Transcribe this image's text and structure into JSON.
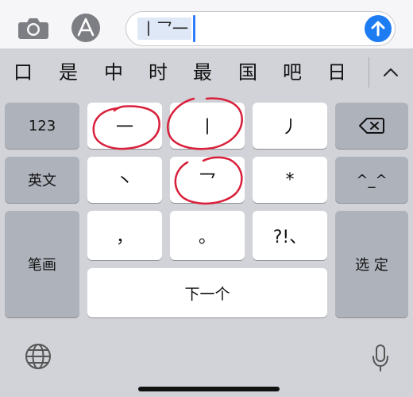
{
  "input": {
    "composition_text": "丨乛一",
    "send_button": "send"
  },
  "candidate_bar": {
    "items": [
      "口",
      "是",
      "中",
      "时",
      "最",
      "国",
      "吧",
      "日"
    ],
    "expand_icon": "chevron-up-icon"
  },
  "keyboard": {
    "key_123": "123",
    "key_english": "英文",
    "key_strokes_mode": "笔画",
    "key_heng": "一",
    "key_shu": "丨",
    "key_pie": "丿",
    "key_dian": "丶",
    "key_zhe": "乛",
    "key_wildcard": "*",
    "key_comma": "，",
    "key_period": "。",
    "key_punct": "?!、",
    "key_next": "下一个",
    "key_emoji": "^_^",
    "key_select": "选 定",
    "delete_icon": "backspace-icon"
  },
  "icons": {
    "camera": "camera-icon",
    "appstore": "app-store-icon",
    "globe": "globe-icon",
    "mic": "microphone-icon"
  },
  "colors": {
    "accent": "#1d7cf2",
    "annotation": "#d91f3a"
  }
}
